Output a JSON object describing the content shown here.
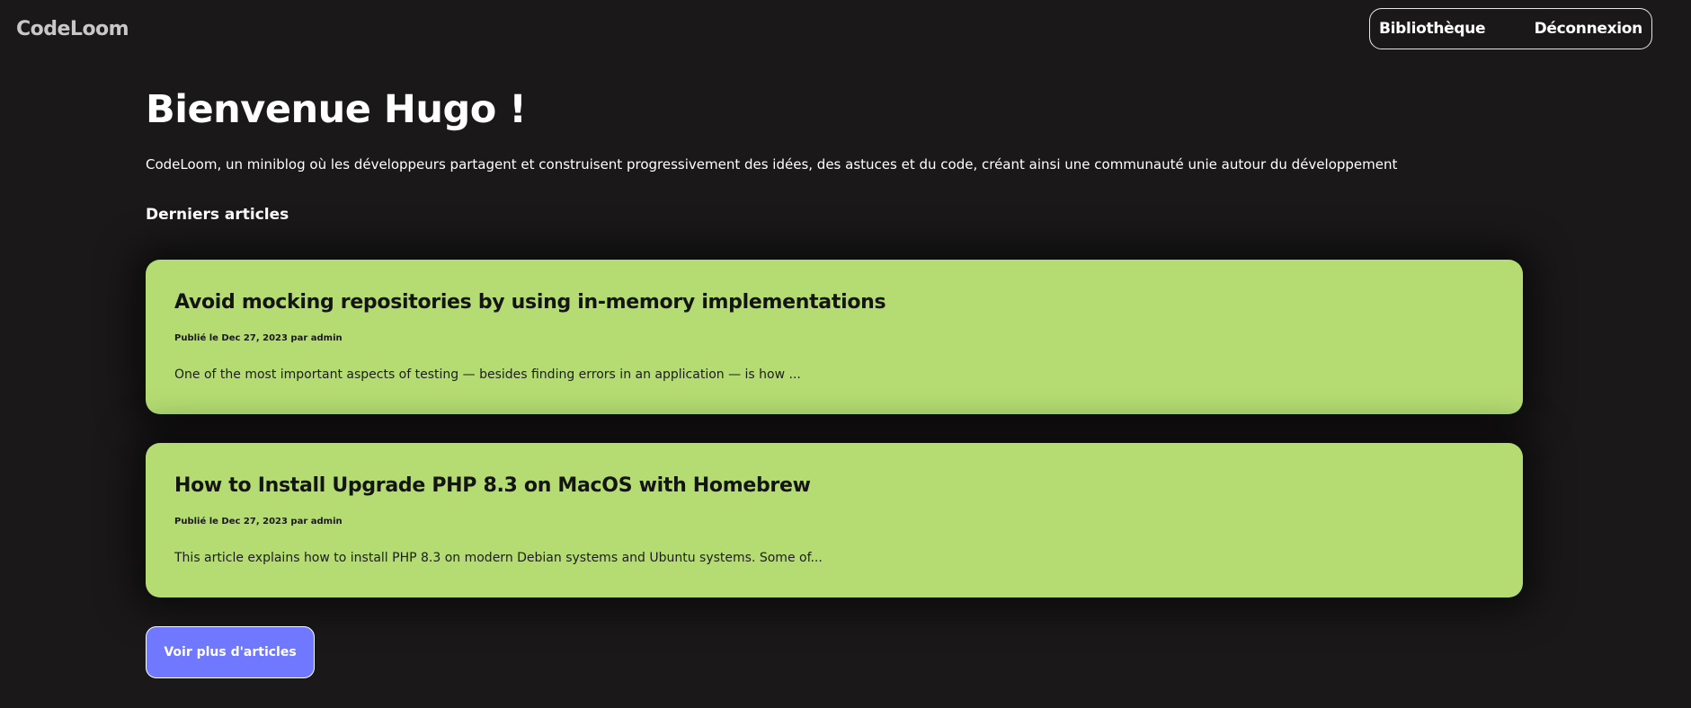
{
  "header": {
    "logo": "CodeLoom",
    "nav": {
      "library_label": "Bibliothèque",
      "logout_label": "Déconnexion"
    }
  },
  "main": {
    "welcome": "Bienvenue Hugo !",
    "intro": "CodeLoom, un miniblog où les développeurs partagent et construisent progressivement des idées, des astuces et du code, créant ainsi une communauté unie autour du développement",
    "section_title": "Derniers articles",
    "articles": [
      {
        "title": "Avoid mocking repositories by using in-memory implementations",
        "meta": "Publié le Dec 27, 2023 par admin",
        "excerpt": "One of the most important aspects of testing — besides finding errors in an application — is how ..."
      },
      {
        "title": "How to Install Upgrade PHP 8.3 on MacOS with Homebrew",
        "meta": "Publié le Dec 27, 2023 par admin",
        "excerpt": "This article explains how to install PHP 8.3 on modern Debian systems and Ubuntu systems. Some of..."
      }
    ],
    "more_button": "Voir plus d'articles"
  },
  "colors": {
    "background": "#1a1819",
    "card": "#b4dc72",
    "button": "#6f78ff",
    "text": "#ffffff"
  }
}
